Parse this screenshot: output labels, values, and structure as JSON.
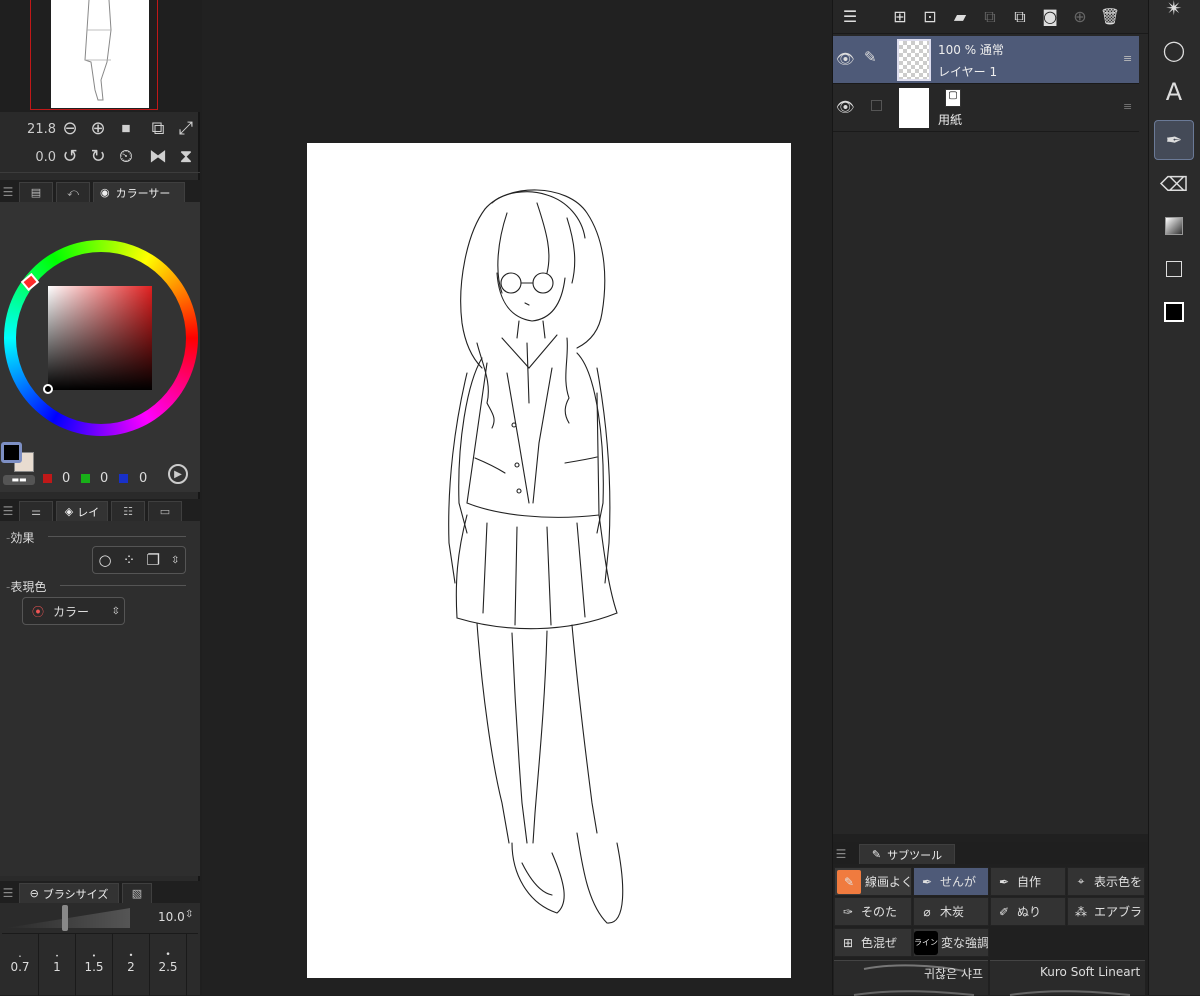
{
  "navigator": {
    "zoom": "21.8",
    "rotation": "0.0"
  },
  "color_panel": {
    "tab_label": "カラーサー",
    "r_value": "0",
    "g_value": "0",
    "b_value": "0",
    "hue_marker_color": "#ff2a2a",
    "main_color": "#000000",
    "sub_color": "#e8dcd0"
  },
  "layer_prop": {
    "tab_label": "レイ",
    "effect_label": "効果",
    "expression_label": "表現色",
    "expression_value": "カラー"
  },
  "brush_size": {
    "tab_label": "ブラシサイズ",
    "value": "10.0",
    "presets": [
      "0.7",
      "1",
      "1.5",
      "2",
      "2.5"
    ]
  },
  "layers": [
    {
      "opacity_mode": "100 % 通常",
      "name": "レイヤー 1",
      "selected": true
    },
    {
      "name": "用紙",
      "selected": false
    }
  ],
  "subtool": {
    "tab_label": "サブツール",
    "items": [
      {
        "label": "線画よく",
        "icon": "pencil-icon"
      },
      {
        "label": "せんが",
        "icon": "pen-icon"
      },
      {
        "label": "自作",
        "icon": "pen-icon"
      },
      {
        "label": "表示色を",
        "icon": "dropper-icon"
      },
      {
        "label": "そのた",
        "icon": "pen-nib-icon"
      },
      {
        "label": "木炭",
        "icon": "charcoal-icon"
      },
      {
        "label": "ぬり",
        "icon": "marker-icon"
      },
      {
        "label": "エアブラ",
        "icon": "airbrush-icon"
      },
      {
        "label": "色混ぜ",
        "icon": "grid-icon"
      },
      {
        "label": "変な強調",
        "icon": "line-brush-icon"
      }
    ],
    "brush_previews": [
      "귀찮은 샤프",
      "Kuro Soft Lineart"
    ]
  },
  "colors": {
    "accent": "#4e5a78",
    "selected_orange": "#f07b3f"
  }
}
